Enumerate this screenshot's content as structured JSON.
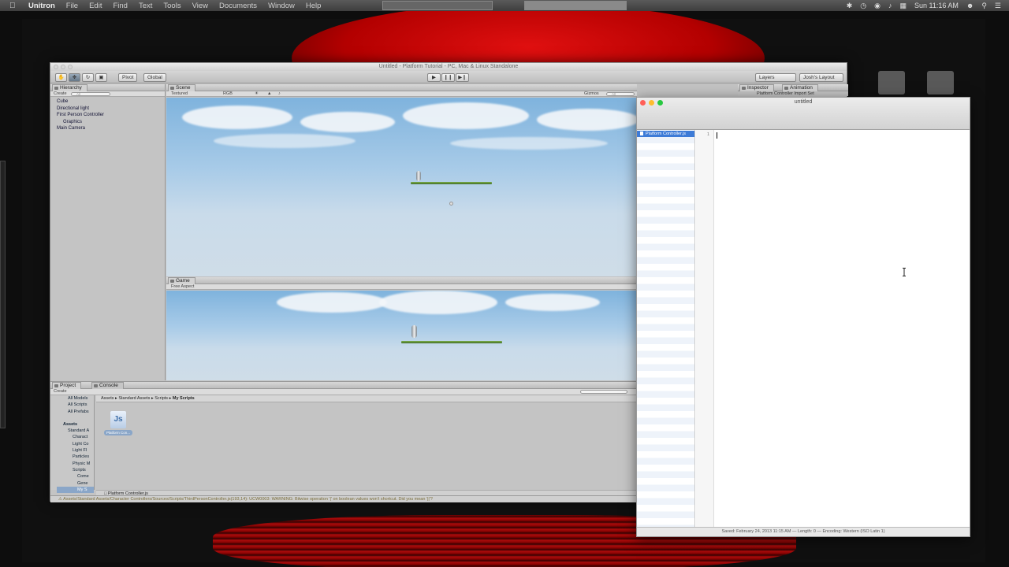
{
  "menubar": {
    "app": "Unitron",
    "items": [
      "File",
      "Edit",
      "Find",
      "Text",
      "Tools",
      "View",
      "Documents",
      "Window",
      "Help"
    ],
    "clock": "Sun 11:16 AM"
  },
  "unity": {
    "title": "Untitled - Platform Tutorial - PC, Mac & Linux Standalone",
    "pivot": "Pivot",
    "global": "Global",
    "layers": "Layers",
    "layout": "Josh's Layout",
    "hierarchy": {
      "tab": "Hierarchy",
      "create": "Create",
      "search": "All",
      "items": [
        {
          "label": "Cube",
          "child": false
        },
        {
          "label": "Directional light",
          "child": false
        },
        {
          "label": "First Person Controller",
          "child": false
        },
        {
          "label": "Graphics",
          "child": true
        },
        {
          "label": "Main Camera",
          "child": false
        }
      ]
    },
    "scene": {
      "tab": "Scene",
      "mode": "Textured",
      "rgb": "RGB",
      "gizmos": "Gizmos",
      "search": "All"
    },
    "game": {
      "tab": "Game",
      "aspect": "Free Aspect"
    },
    "inspector": {
      "tab": "Inspector",
      "anim_tab": "Animation",
      "subtitle": "Platform Controller Import Set"
    },
    "project": {
      "tab": "Project",
      "console_tab": "Console",
      "create": "Create",
      "breadcrumb": [
        "Assets",
        "Standard Assets",
        "Scripts",
        "My Scripts"
      ],
      "favorites": [
        "All Models",
        "All Scripts",
        "All Prefabs"
      ],
      "tree": [
        "Assets",
        "Standard A",
        "Charact",
        "Light Co",
        "Light Fl",
        "Particles",
        "Physic M",
        "Scripts",
        "Come",
        "Gene",
        "My S"
      ],
      "file_icon": "Js",
      "file_label": "Platform Con...",
      "footer_file": "Platform Controller.js"
    },
    "status": "Assets/Standard Assets/Character Controllers/Sources/Scripts/ThirdPersonController.js(193,14): UCW0003: WARNING: Bitwise operation '|' on boolean values won't shortcut. Did you mean '||'?"
  },
  "editor": {
    "title": "untitled",
    "sidebar_file": "Platform Controller.js",
    "line_number": "1",
    "status": "Saved: February 24, 2013 11:15 AM  —  Length: 0  —  Encoding: Western (ISO Latin 1)"
  },
  "colors": {
    "close": "#ff5f57",
    "minimize": "#febc2e",
    "zoom": "#28c840",
    "selection": "#3d7bd7"
  }
}
